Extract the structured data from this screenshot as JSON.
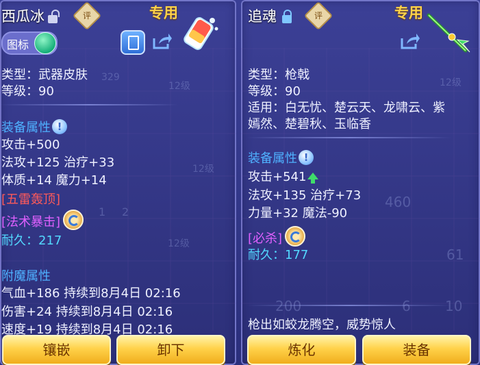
{
  "left_panel": {
    "title": "西瓜冰",
    "rating_label": "评",
    "special_label": "专用",
    "icon_toggle_label": "图标",
    "type_line": "类型：武器皮肤",
    "level_line": "等级：90",
    "equip_attr_title": "装备属性",
    "attr_lines": [
      "攻击+500",
      "法攻+125 治疗+33",
      "体质+14 魔力+14"
    ],
    "skill_1": "[五雷轰顶]",
    "skill_2": "[法术暴击]",
    "durability": "耐久：217",
    "enchant_title": "附魔属性",
    "enchant_lines": [
      "气血+186 持续到8月4日 02:16",
      "伤害+24 持续到8月4日 02:16",
      "速度+19 持续到8月4日 02:16"
    ],
    "btn_inlay": "镶嵌",
    "btn_unequip": "卸下"
  },
  "right_panel": {
    "title": "追魂",
    "rating_label": "评",
    "special_label": "专用",
    "type_line": "类型：枪戟",
    "level_line": "等级：90",
    "applicable_line1": "适用：白无忧、楚云天、龙啸云、紫",
    "applicable_line2": "嫣然、楚碧秋、玉临香",
    "equip_attr_title": "装备属性",
    "attr_lines": [
      "攻击+541",
      "法攻+135 治疗+73",
      "力量+32 魔法-90"
    ],
    "skill_1": "[必杀]",
    "durability": "耐久：177",
    "flavor_text": "枪出如蛟龙腾空，威势惊人",
    "btn_refine": "炼化",
    "btn_equip": "装备"
  },
  "background_numbers": [
    "12级",
    "12级",
    "12级",
    "12级",
    "329",
    "460",
    "61",
    "200",
    "6",
    "10",
    "1",
    "2"
  ],
  "colors": {
    "section": "#4fb1ff",
    "skill_red": "#ff5a5a",
    "skill_purple": "#e060ff",
    "durability": "#53d8ff",
    "special": "#ffd34a",
    "button_gold": "#ffd24a",
    "button_text": "#6b3400"
  }
}
